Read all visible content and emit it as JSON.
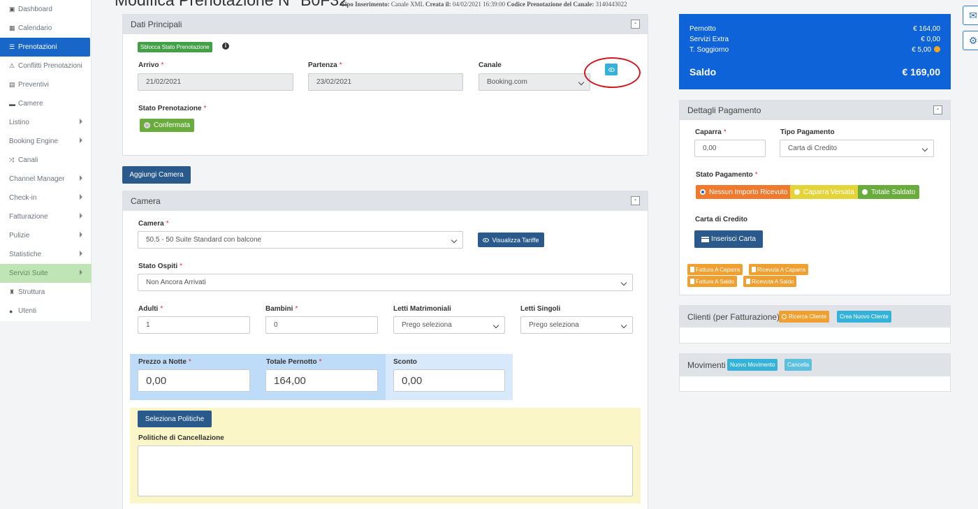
{
  "sidebar": {
    "items": [
      {
        "label": "Dashboard",
        "icon": "monitor-icon",
        "glyph": "▣"
      },
      {
        "label": "Calendario",
        "icon": "calendar-icon",
        "glyph": "▦"
      },
      {
        "label": "Prenotazioni",
        "icon": "list-icon",
        "glyph": "☰"
      },
      {
        "label": "Conflitti Prenotazioni",
        "icon": "warning-icon",
        "glyph": "⚠"
      },
      {
        "label": "Preventivi",
        "icon": "document-icon",
        "glyph": "▤"
      },
      {
        "label": "Camere",
        "icon": "bed-icon",
        "glyph": "▬"
      },
      {
        "label": "Listino",
        "icon": "",
        "glyph": ""
      },
      {
        "label": "Booking Engine",
        "icon": "",
        "glyph": ""
      },
      {
        "label": "Canali",
        "icon": "random-icon",
        "glyph": "⤨"
      },
      {
        "label": "Channel Manager",
        "icon": "",
        "glyph": ""
      },
      {
        "label": "Check-in",
        "icon": "",
        "glyph": ""
      },
      {
        "label": "Fatturazione",
        "icon": "",
        "glyph": ""
      },
      {
        "label": "Pulizie",
        "icon": "",
        "glyph": ""
      },
      {
        "label": "Statistiche",
        "icon": "",
        "glyph": ""
      },
      {
        "label": "Servizi Suite",
        "icon": "",
        "glyph": ""
      },
      {
        "label": "Struttura",
        "icon": "building-icon",
        "glyph": "♜"
      },
      {
        "label": "Utenti",
        "icon": "user-icon",
        "glyph": "●"
      }
    ]
  },
  "header": {
    "title": "Modifica Prenotazione N° B0F32",
    "meta_type_label": "Tipo Inserimento:",
    "meta_type_value": "Canale XML",
    "meta_created_label": "Creata il:",
    "meta_created_value": "04/02/2021 16:39:00",
    "meta_code_label": "Codice Prenotazione del Canale:",
    "meta_code_value": "3140443022"
  },
  "dati_principali": {
    "title": "Dati Principali",
    "collapse": "-",
    "unlock_button": "Sblocca Stato Prenotazione",
    "arrivo_label": "Arrivo",
    "arrivo_value": "21/02/2021",
    "partenza_label": "Partenza",
    "partenza_value": "23/02/2021",
    "canale_label": "Canale",
    "canale_value": "Booking.com",
    "stato_label": "Stato Prenotazione",
    "stato_value": "Confermata",
    "required_mark": "*"
  },
  "aggiungi_camera": "Aggiungi Camera",
  "camera_panel": {
    "title": "Camera",
    "collapse": "-",
    "camera_label": "Camera",
    "camera_value": "50.5 - 50 Suite Standard con balcone",
    "visualizza_tariffe": "Visualizza Tariffe",
    "stato_ospiti_label": "Stato Ospiti",
    "stato_ospiti_value": "Non Ancora Arrivati",
    "adulti_label": "Adulti",
    "adulti_value": "1",
    "bambini_label": "Bambini",
    "bambini_value": "0",
    "letti_matrimoniali_label": "Letti Matrimoniali",
    "letti_matrimoniali_value": "Prego seleziona",
    "letti_singoli_label": "Letti Singoli",
    "letti_singoli_value": "Prego seleziona",
    "prezzo_notte_label": "Prezzo a Notte",
    "prezzo_notte_value": "0,00",
    "totale_pernotto_label": "Totale Pernotto",
    "totale_pernotto_value": "164,00",
    "sconto_label": "Sconto",
    "sconto_value": "0,00",
    "seleziona_politiche": "Seleziona Politiche",
    "politiche_label": "Politiche di Cancellazione",
    "politiche_value": ""
  },
  "summary": {
    "pernotto_label": "Pernotto",
    "pernotto_value": "€ 164,00",
    "servizi_label": "Servizi Extra",
    "servizi_value": "€ 0,00",
    "soggiorno_label": "T. Soggiorno",
    "soggiorno_value": "€ 5,00",
    "saldo_label": "Saldo",
    "saldo_value": "€ 169,00"
  },
  "pagamento": {
    "title": "Dettagli Pagamento",
    "collapse": "-",
    "caparra_label": "Caparra",
    "caparra_value": "0,00",
    "tipo_label": "Tipo Pagamento",
    "tipo_value": "Carta di Credito",
    "stato_label": "Stato Pagamento",
    "opt_nessun": "Nessun Importo Ricevuto",
    "opt_caparra": "Caparra Versata",
    "opt_saldato": "Totale Saldato",
    "carta_label": "Carta di Credito",
    "inserisci_carta": "Inserisci Carta",
    "fattura_caparra": "Fattura A Caparra",
    "ricevuta_caparra": "Ricevuta A Caparra",
    "fattura_saldo": "Fattura A Saldo",
    "ricevuta_saldo": "Ricevuta A Saldo"
  },
  "clienti": {
    "title": "Clienti (per Fatturazione)",
    "ricerca": "Ricerca Cliente",
    "crea": "Crea Nuovo Cliente"
  },
  "movimenti": {
    "title": "Movimenti",
    "nuovo": "Nuovo Movimento",
    "cancella": "Cancella"
  },
  "colors": {
    "primary": "#1866c7",
    "summary_bg": "#0e63d8",
    "navy_button": "#2a5a8c",
    "green": "#43a047",
    "cyan": "#35b2d8",
    "orange": "#f0a030",
    "highlight_red": "#d0191e"
  }
}
